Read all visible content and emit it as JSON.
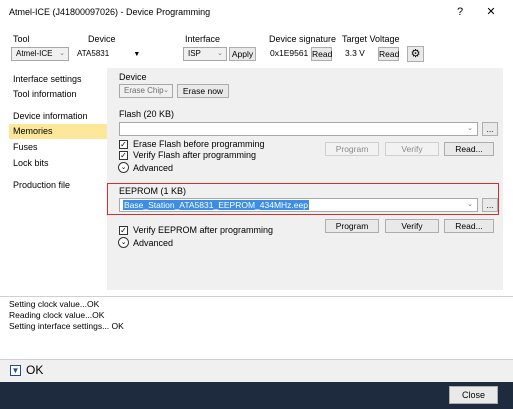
{
  "window": {
    "title": "Atmel-ICE (J41800097026) - Device Programming",
    "help_label": "?",
    "close_label": "✕"
  },
  "toolbar": {
    "tool_label": "Tool",
    "tool_value": "Atmel-ICE",
    "device_label": "Device",
    "device_value": "ATA5831",
    "interface_label": "Interface",
    "interface_value": "ISP",
    "apply_label": "Apply",
    "signature_label": "Device signature",
    "signature_value": "0x1E9561",
    "read_signature_label": "Read",
    "voltage_label": "Target Voltage",
    "voltage_value": "3.3 V",
    "read_voltage_label": "Read",
    "settings_icon": "gear-icon"
  },
  "sidebar": {
    "items": [
      {
        "label": "Interface settings"
      },
      {
        "label": "Tool information"
      },
      {
        "label": "Device information"
      },
      {
        "label": "Memories"
      },
      {
        "label": "Fuses"
      },
      {
        "label": "Lock bits"
      },
      {
        "label": "Production file"
      }
    ],
    "selected": "Memories"
  },
  "device_section": {
    "label": "Device",
    "erase_select": "Erase Chip",
    "erase_now_label": "Erase now"
  },
  "flash_section": {
    "label": "Flash (20 KB)",
    "file_value": "",
    "browse_label": "...",
    "erase_before_label": "Erase Flash before programming",
    "verify_label": "Verify Flash after programming",
    "advanced_label": "Advanced",
    "program_label": "Program",
    "verify_button_label": "Verify",
    "read_label": "Read..."
  },
  "eeprom_section": {
    "label": "EEPROM (1 KB)",
    "file_value": "Base_Station_ATA5831_EEPROM_434MHz.eep",
    "browse_label": "...",
    "verify_label": "Verify EEPROM after programming",
    "advanced_label": "Advanced",
    "program_label": "Program",
    "verify_button_label": "Verify",
    "read_label": "Read..."
  },
  "log": {
    "lines": [
      "Setting clock value...OK",
      "Reading clock value...OK",
      "Setting interface settings... OK"
    ]
  },
  "status": {
    "text": "OK"
  },
  "footer": {
    "close_label": "Close"
  }
}
